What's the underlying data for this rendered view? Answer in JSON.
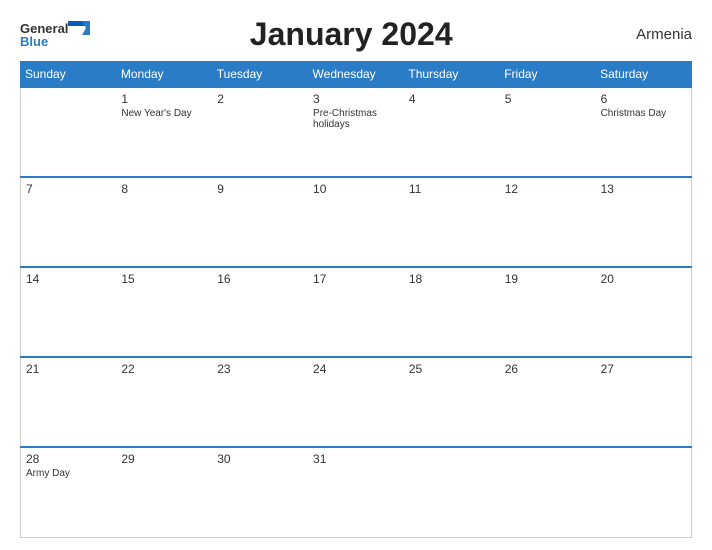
{
  "header": {
    "title": "January 2024",
    "country": "Armenia",
    "logo": {
      "general": "General",
      "blue": "Blue"
    }
  },
  "calendar": {
    "days_of_week": [
      "Sunday",
      "Monday",
      "Tuesday",
      "Wednesday",
      "Thursday",
      "Friday",
      "Saturday"
    ],
    "weeks": [
      [
        {
          "num": "",
          "holiday": ""
        },
        {
          "num": "1",
          "holiday": "New Year's Day"
        },
        {
          "num": "2",
          "holiday": ""
        },
        {
          "num": "3",
          "holiday": "Pre-Christmas holidays"
        },
        {
          "num": "4",
          "holiday": ""
        },
        {
          "num": "5",
          "holiday": ""
        },
        {
          "num": "6",
          "holiday": "Christmas Day"
        }
      ],
      [
        {
          "num": "7",
          "holiday": ""
        },
        {
          "num": "8",
          "holiday": ""
        },
        {
          "num": "9",
          "holiday": ""
        },
        {
          "num": "10",
          "holiday": ""
        },
        {
          "num": "11",
          "holiday": ""
        },
        {
          "num": "12",
          "holiday": ""
        },
        {
          "num": "13",
          "holiday": ""
        }
      ],
      [
        {
          "num": "14",
          "holiday": ""
        },
        {
          "num": "15",
          "holiday": ""
        },
        {
          "num": "16",
          "holiday": ""
        },
        {
          "num": "17",
          "holiday": ""
        },
        {
          "num": "18",
          "holiday": ""
        },
        {
          "num": "19",
          "holiday": ""
        },
        {
          "num": "20",
          "holiday": ""
        }
      ],
      [
        {
          "num": "21",
          "holiday": ""
        },
        {
          "num": "22",
          "holiday": ""
        },
        {
          "num": "23",
          "holiday": ""
        },
        {
          "num": "24",
          "holiday": ""
        },
        {
          "num": "25",
          "holiday": ""
        },
        {
          "num": "26",
          "holiday": ""
        },
        {
          "num": "27",
          "holiday": ""
        }
      ],
      [
        {
          "num": "28",
          "holiday": "Army Day"
        },
        {
          "num": "29",
          "holiday": ""
        },
        {
          "num": "30",
          "holiday": ""
        },
        {
          "num": "31",
          "holiday": ""
        },
        {
          "num": "",
          "holiday": ""
        },
        {
          "num": "",
          "holiday": ""
        },
        {
          "num": "",
          "holiday": ""
        }
      ]
    ],
    "row_shading": [
      "dark",
      "light",
      "dark",
      "light",
      "dark"
    ]
  }
}
